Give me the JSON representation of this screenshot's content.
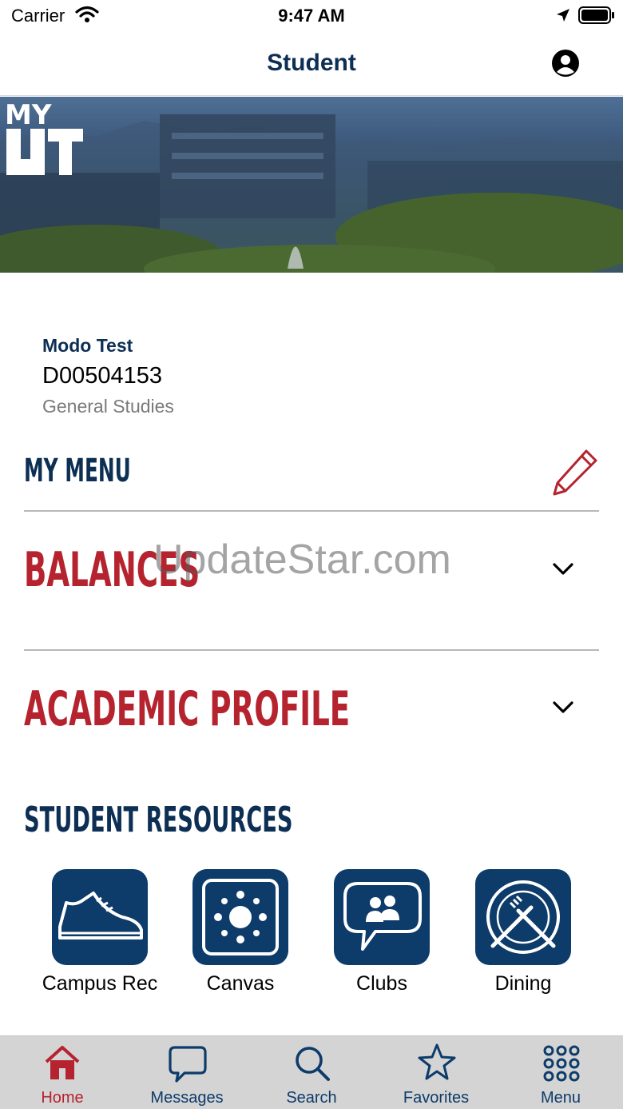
{
  "status_bar": {
    "carrier": "Carrier",
    "time": "9:47 AM"
  },
  "nav": {
    "title": "Student",
    "profile_icon": "person-circle-icon"
  },
  "hero": {
    "logo_text_top": "MY",
    "logo_text_bottom": "UT"
  },
  "profile": {
    "name": "Modo Test",
    "id": "D00504153",
    "program": "General Studies"
  },
  "my_menu": {
    "title": "MY MENU",
    "edit_icon": "pencil-icon"
  },
  "accordions": [
    {
      "title": "BALANCES",
      "icon": "chevron-down-icon"
    },
    {
      "title": "ACADEMIC PROFILE",
      "icon": "chevron-down-icon"
    }
  ],
  "watermark": "UpdateStar.com",
  "resources": {
    "title": "STUDENT RESOURCES",
    "items": [
      {
        "label": "Campus Rec",
        "icon": "sneaker-icon"
      },
      {
        "label": "Canvas",
        "icon": "canvas-logo-icon"
      },
      {
        "label": "Clubs",
        "icon": "chat-group-icon"
      },
      {
        "label": "Dining",
        "icon": "plate-utensils-icon"
      }
    ]
  },
  "tabbar": {
    "tabs": [
      {
        "label": "Home",
        "icon": "home-icon",
        "active": true
      },
      {
        "label": "Messages",
        "icon": "chat-bubble-icon",
        "active": false
      },
      {
        "label": "Search",
        "icon": "magnifier-icon",
        "active": false
      },
      {
        "label": "Favorites",
        "icon": "star-icon",
        "active": false
      },
      {
        "label": "Menu",
        "icon": "grid-dots-icon",
        "active": false
      }
    ]
  },
  "colors": {
    "navy": "#0d2f54",
    "tile_blue": "#0d3b6a",
    "red": "#b5232f",
    "tabbar_bg": "#d4d4d4"
  }
}
